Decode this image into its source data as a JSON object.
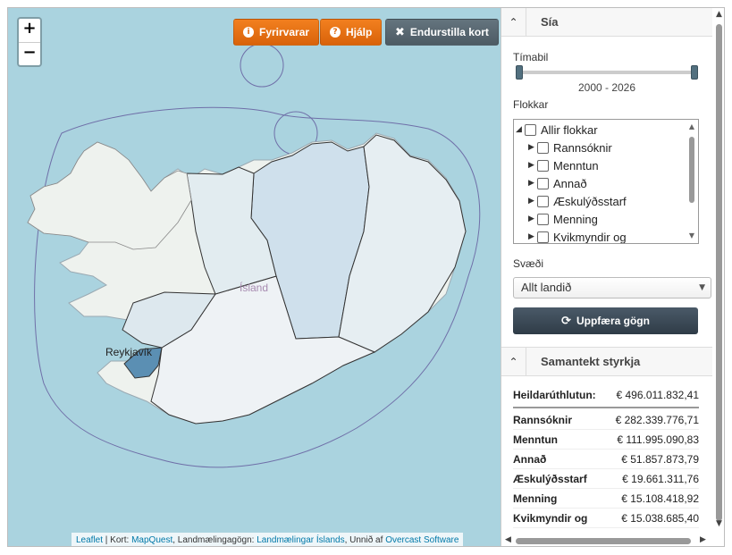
{
  "map": {
    "zoom_in": "+",
    "zoom_out": "−",
    "buttons": {
      "disclaimer": "Fyrirvarar",
      "help": "Hjálp",
      "reset": "Endurstilla kort"
    },
    "country_label": "Ísland",
    "city_label": "Reykjavík",
    "attribution": {
      "leaflet": "Leaflet",
      "sep1": " | Kort: ",
      "mapquest": "MapQuest",
      "sep2": ", Landmælingagögn: ",
      "lmi": "Landmælingar Íslands",
      "sep3": ", Unnið af ",
      "overcast": "Overcast Software"
    },
    "colors": {
      "sea": "#aad3df",
      "land": "#eef2ee",
      "region_fill": "#cfe0ec",
      "reykjavik_fill": "#5b8fb3"
    }
  },
  "sidebar": {
    "filter_title": "Sía",
    "period_label": "Tímabil",
    "period_range": "2000 - 2026",
    "period_start_fraction": 0.0,
    "period_end_fraction": 1.0,
    "categories_label": "Flokkar",
    "categories": {
      "all": "Allir flokkar",
      "items": [
        "Rannsóknir",
        "Menntun",
        "Annað",
        "Æskulýðsstarf",
        "Menning",
        "Kvikmyndir og"
      ]
    },
    "region_label": "Svæði",
    "region_value": "Allt landið",
    "update_button": "Uppfæra gögn",
    "summary_title": "Samantekt styrkja",
    "summary": {
      "total_label": "Heildarúthlutun:",
      "total_value": "€ 496.011.832,41",
      "rows": [
        {
          "label": "Rannsóknir",
          "value": "€ 282.339.776,71"
        },
        {
          "label": "Menntun",
          "value": "€ 111.995.090,83"
        },
        {
          "label": "Annað",
          "value": "€ 51.857.873,79"
        },
        {
          "label": "Æskulýðsstarf",
          "value": "€ 19.661.311,76"
        },
        {
          "label": "Menning",
          "value": "€ 15.108.418,92"
        },
        {
          "label": "Kvikmyndir og",
          "value": "€ 15.038.685,40"
        }
      ]
    }
  },
  "icons": {
    "disclaimer": "info-icon",
    "help": "question-icon",
    "reset": "close-icon",
    "update": "refresh-icon",
    "collapse": "chevron-up-icon"
  }
}
